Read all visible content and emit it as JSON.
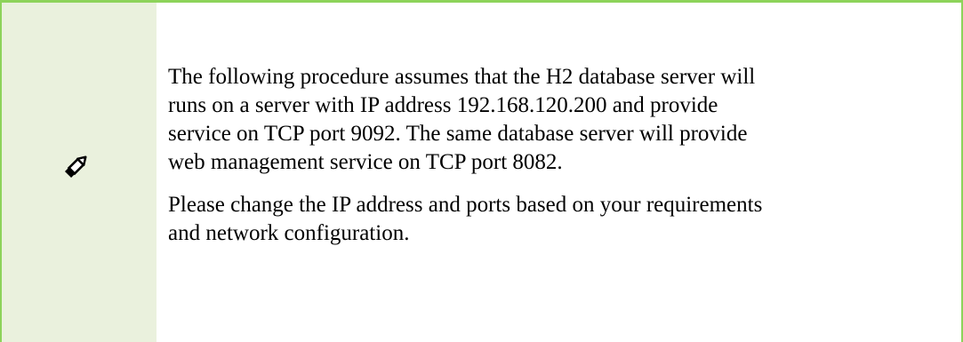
{
  "note": {
    "icon": "pencil-icon",
    "border_color": "#8dd35a",
    "icon_column_background": "#eaf1dd",
    "paragraphs": [
      {
        "lines": [
          "The following procedure assumes that the H2 database server will",
          "runs on a server with IP address 192.168.120.200 and provide",
          "service on TCP port 9092. The same database server will provide",
          "web management service on TCP port 8082."
        ]
      },
      {
        "lines": [
          "Please change the IP address and ports based on your requirements",
          "and network configuration."
        ]
      }
    ]
  }
}
